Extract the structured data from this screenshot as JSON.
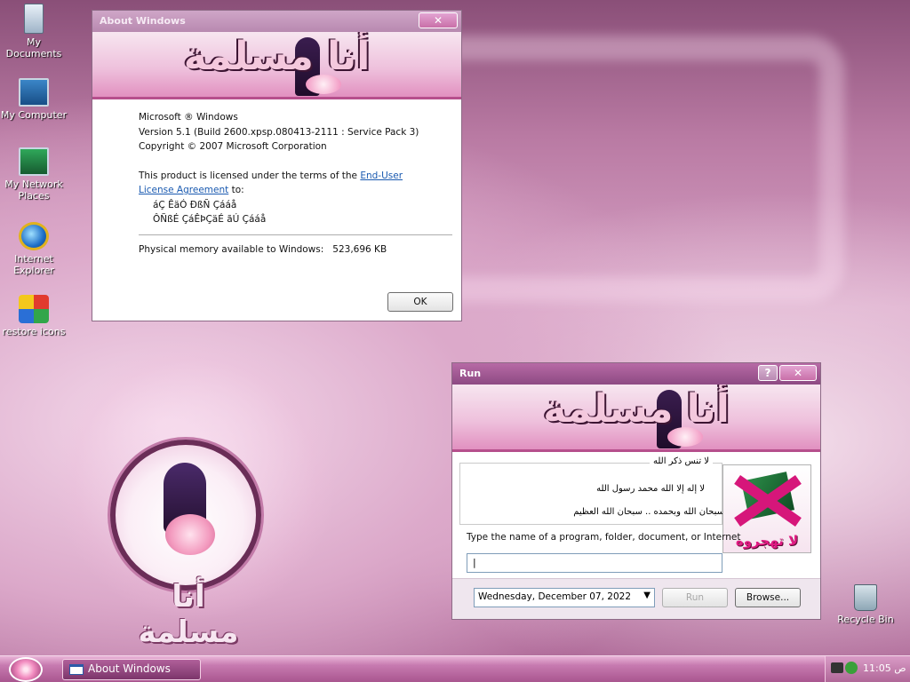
{
  "desktop": {
    "icons": [
      {
        "label": "My Documents",
        "icon": "my-documents-icon"
      },
      {
        "label": "My Computer",
        "icon": "my-computer-icon"
      },
      {
        "label": "My Network Places",
        "icon": "network-places-icon"
      },
      {
        "label": "Internet Explorer",
        "icon": "internet-explorer-icon"
      },
      {
        "label": "restore icons",
        "icon": "restore-icon"
      },
      {
        "label": "Recycle Bin",
        "icon": "recycle-bin-icon"
      }
    ],
    "wallpaper_text": "أنا مسلمة"
  },
  "about": {
    "title": "About Windows",
    "banner_text": "أنا مسلمة",
    "line1": "Microsoft ® Windows",
    "line2": "Version 5.1 (Build 2600.xpsp.080413-2111 : Service Pack 3)",
    "line3": "Copyright © 2007 Microsoft Corporation",
    "license_pre": "This product is licensed under the terms of the ",
    "license_link1": "End-User",
    "license_link2": "License Agreement",
    "license_post": " to:",
    "licensee1": "áÇ ÊäÓ ÐßÑ Çááå",
    "licensee2": "ÔÑßÉ ÇáÊÞÇäÉ ãÚ Çááå",
    "memory_label": "Physical memory available to Windows:",
    "memory_value": "523,696 KB",
    "ok_label": "OK"
  },
  "run": {
    "title": "Run",
    "help_label": "?",
    "close_label": "✕",
    "banner_text": "أنا مسلمة",
    "group_title": "لا تنس ذكر الله",
    "line1": "لا إله إلا الله محمد رسول الله",
    "line2": "سبحان الله وبحمده .. سبحان الله العظيم",
    "quran_caption": "لا تهجروه",
    "prompt": "Type the name of a program, folder, document, or Internet",
    "input_value": "",
    "date": "Wednesday,  December  07, 2022",
    "run_label": "Run",
    "browse_label": "Browse..."
  },
  "taskbar": {
    "task_label": "About Windows",
    "clock": "11:05 ص"
  }
}
